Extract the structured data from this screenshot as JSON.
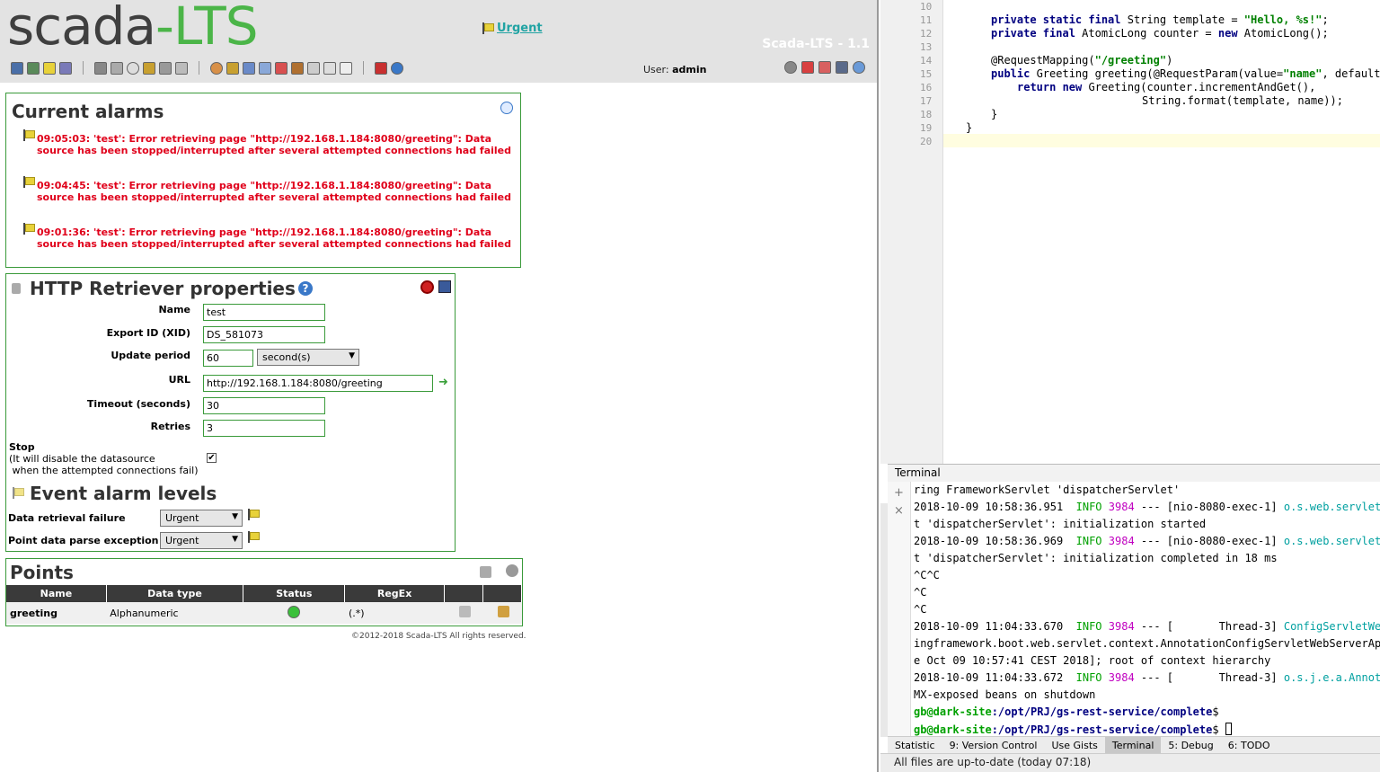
{
  "header": {
    "logo_a": "scada",
    "logo_b": "LTS",
    "urgent_link": "Urgent",
    "version": "Scada-LTS - 1.1",
    "user_label": "User:",
    "user_name": "admin"
  },
  "alarms": {
    "title": "Current alarms",
    "items": [
      {
        "time": "09:05:03:",
        "text": "'test': Error retrieving page \"http://192.168.1.184:8080/greeting\": Data source has been stopped/interrupted after several attempted connections had failed"
      },
      {
        "time": "09:04:45:",
        "text": "'test': Error retrieving page \"http://192.168.1.184:8080/greeting\": Data source has been stopped/interrupted after several attempted connections had failed"
      },
      {
        "time": "09:01:36:",
        "text": "'test': Error retrieving page \"http://192.168.1.184:8080/greeting\": Data source has been stopped/interrupted after several attempted connections had failed"
      }
    ]
  },
  "props": {
    "title": "HTTP Retriever properties",
    "name_label": "Name",
    "name_value": "test",
    "xid_label": "Export ID (XID)",
    "xid_value": "DS_581073",
    "period_label": "Update period",
    "period_value": "60",
    "period_unit": "second(s)",
    "url_label": "URL",
    "url_value": "http://192.168.1.184:8080/greeting",
    "timeout_label": "Timeout (seconds)",
    "timeout_value": "30",
    "retries_label": "Retries",
    "retries_value": "3",
    "stop_label": "Stop",
    "stop_note1": "(It will disable the datasource",
    "stop_note2": " when the attempted connections fail)",
    "stop_checked": true
  },
  "events": {
    "title": "Event alarm levels",
    "rows": [
      {
        "label": "Data retrieval failure",
        "value": "Urgent"
      },
      {
        "label": "Point data parse exception",
        "value": "Urgent"
      }
    ]
  },
  "points": {
    "title": "Points",
    "headers": [
      "Name",
      "Data type",
      "Status",
      "RegEx"
    ],
    "rows": [
      {
        "name": "greeting",
        "type": "Alphanumeric",
        "regex": "(.*)"
      }
    ]
  },
  "footer": "©2012-2018 Scada-LTS All rights reserved.",
  "editor": {
    "lines": [
      "10",
      "11",
      "12",
      "13",
      "14",
      "15",
      "16",
      "17",
      "18",
      "19",
      "20"
    ],
    "code": {
      "l11_kw": "private static final",
      "l11_rest": " String template = ",
      "l11_str": "\"Hello, %s!\"",
      "l11_end": ";",
      "l12_kw": "private final",
      "l12_mid": " AtomicLong counter = ",
      "l12_kw2": "new",
      "l12_end": " AtomicLong();",
      "l14_a": "@RequestMapping(",
      "l14_str": "\"/greeting\"",
      "l14_b": ")",
      "l15_kw": "public",
      "l15_a": " Greeting greeting(@RequestParam(value=",
      "l15_str": "\"name\"",
      "l15_b": ", defaultVa",
      "l16_kw": "return new",
      "l16_a": " Greeting(counter.incrementAndGet(),",
      "l17": "String.format(template, name));",
      "l18": "}",
      "l19": "}"
    }
  },
  "terminal": {
    "title": "Terminal",
    "l1": "ring FrameworkServlet 'dispatcherServlet'",
    "l2_ts": "2018-10-09 10:58:36.951  ",
    "l2_lvl": "INFO",
    "l2_pid": "3984",
    "l2_mid": " --- [nio-8080-exec-1] ",
    "l2_cls": "o.s.web.servlet.D",
    "l3": "t 'dispatcherServlet': initialization started",
    "l4_ts": "2018-10-09 10:58:36.969  ",
    "l4_lvl": "INFO",
    "l4_pid": "3984",
    "l4_mid": " --- [nio-8080-exec-1] ",
    "l4_cls": "o.s.web.servlet.D",
    "l5": "t 'dispatcherServlet': initialization completed in 18 ms",
    "l6": "^C^C",
    "l7": "^C",
    "l8": "^C",
    "l9_ts": "2018-10-09 11:04:33.670  ",
    "l9_lvl": "INFO",
    "l9_pid": "3984",
    "l9_mid": " --- [       Thread-3] ",
    "l9_cls": "ConfigServletWebS",
    "l10": "ingframework.boot.web.servlet.context.AnnotationConfigServletWebServerAppl",
    "l11": "e Oct 09 10:57:41 CEST 2018]; root of context hierarchy",
    "l12_ts": "2018-10-09 11:04:33.672  ",
    "l12_lvl": "INFO",
    "l12_pid": "3984",
    "l12_mid": " --- [       Thread-3] ",
    "l12_cls": "o.s.j.e.a.Annotat",
    "l13": "MX-exposed beans on shutdown",
    "prompt_user": "gb@dark-site",
    "prompt_path": ":/opt/PRJ/gs-rest-service/complete",
    "prompt_end": "$"
  },
  "bottom_tabs": [
    "Statistic",
    "9: Version Control",
    "Use Gists",
    "Terminal",
    "5: Debug",
    "6: TODO"
  ],
  "status": "All files are up-to-date (today 07:18)"
}
